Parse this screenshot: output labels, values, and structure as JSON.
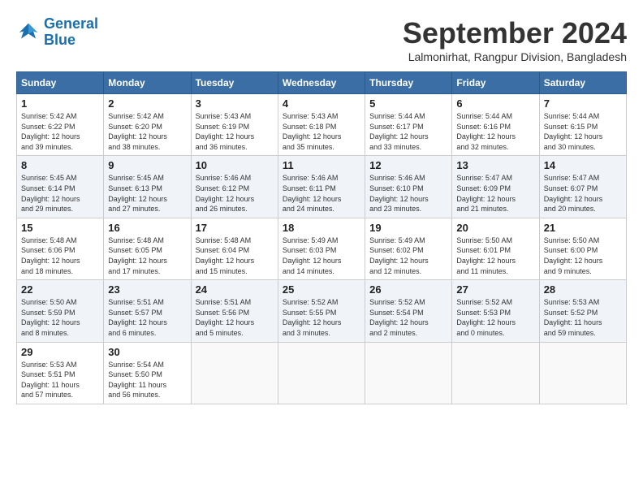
{
  "header": {
    "logo_line1": "General",
    "logo_line2": "Blue",
    "month_title": "September 2024",
    "location": "Lalmonirhat, Rangpur Division, Bangladesh"
  },
  "weekdays": [
    "Sunday",
    "Monday",
    "Tuesday",
    "Wednesday",
    "Thursday",
    "Friday",
    "Saturday"
  ],
  "weeks": [
    [
      {
        "day": 1,
        "info": "Sunrise: 5:42 AM\nSunset: 6:22 PM\nDaylight: 12 hours\nand 39 minutes."
      },
      {
        "day": 2,
        "info": "Sunrise: 5:42 AM\nSunset: 6:20 PM\nDaylight: 12 hours\nand 38 minutes."
      },
      {
        "day": 3,
        "info": "Sunrise: 5:43 AM\nSunset: 6:19 PM\nDaylight: 12 hours\nand 36 minutes."
      },
      {
        "day": 4,
        "info": "Sunrise: 5:43 AM\nSunset: 6:18 PM\nDaylight: 12 hours\nand 35 minutes."
      },
      {
        "day": 5,
        "info": "Sunrise: 5:44 AM\nSunset: 6:17 PM\nDaylight: 12 hours\nand 33 minutes."
      },
      {
        "day": 6,
        "info": "Sunrise: 5:44 AM\nSunset: 6:16 PM\nDaylight: 12 hours\nand 32 minutes."
      },
      {
        "day": 7,
        "info": "Sunrise: 5:44 AM\nSunset: 6:15 PM\nDaylight: 12 hours\nand 30 minutes."
      }
    ],
    [
      {
        "day": 8,
        "info": "Sunrise: 5:45 AM\nSunset: 6:14 PM\nDaylight: 12 hours\nand 29 minutes."
      },
      {
        "day": 9,
        "info": "Sunrise: 5:45 AM\nSunset: 6:13 PM\nDaylight: 12 hours\nand 27 minutes."
      },
      {
        "day": 10,
        "info": "Sunrise: 5:46 AM\nSunset: 6:12 PM\nDaylight: 12 hours\nand 26 minutes."
      },
      {
        "day": 11,
        "info": "Sunrise: 5:46 AM\nSunset: 6:11 PM\nDaylight: 12 hours\nand 24 minutes."
      },
      {
        "day": 12,
        "info": "Sunrise: 5:46 AM\nSunset: 6:10 PM\nDaylight: 12 hours\nand 23 minutes."
      },
      {
        "day": 13,
        "info": "Sunrise: 5:47 AM\nSunset: 6:09 PM\nDaylight: 12 hours\nand 21 minutes."
      },
      {
        "day": 14,
        "info": "Sunrise: 5:47 AM\nSunset: 6:07 PM\nDaylight: 12 hours\nand 20 minutes."
      }
    ],
    [
      {
        "day": 15,
        "info": "Sunrise: 5:48 AM\nSunset: 6:06 PM\nDaylight: 12 hours\nand 18 minutes."
      },
      {
        "day": 16,
        "info": "Sunrise: 5:48 AM\nSunset: 6:05 PM\nDaylight: 12 hours\nand 17 minutes."
      },
      {
        "day": 17,
        "info": "Sunrise: 5:48 AM\nSunset: 6:04 PM\nDaylight: 12 hours\nand 15 minutes."
      },
      {
        "day": 18,
        "info": "Sunrise: 5:49 AM\nSunset: 6:03 PM\nDaylight: 12 hours\nand 14 minutes."
      },
      {
        "day": 19,
        "info": "Sunrise: 5:49 AM\nSunset: 6:02 PM\nDaylight: 12 hours\nand 12 minutes."
      },
      {
        "day": 20,
        "info": "Sunrise: 5:50 AM\nSunset: 6:01 PM\nDaylight: 12 hours\nand 11 minutes."
      },
      {
        "day": 21,
        "info": "Sunrise: 5:50 AM\nSunset: 6:00 PM\nDaylight: 12 hours\nand 9 minutes."
      }
    ],
    [
      {
        "day": 22,
        "info": "Sunrise: 5:50 AM\nSunset: 5:59 PM\nDaylight: 12 hours\nand 8 minutes."
      },
      {
        "day": 23,
        "info": "Sunrise: 5:51 AM\nSunset: 5:57 PM\nDaylight: 12 hours\nand 6 minutes."
      },
      {
        "day": 24,
        "info": "Sunrise: 5:51 AM\nSunset: 5:56 PM\nDaylight: 12 hours\nand 5 minutes."
      },
      {
        "day": 25,
        "info": "Sunrise: 5:52 AM\nSunset: 5:55 PM\nDaylight: 12 hours\nand 3 minutes."
      },
      {
        "day": 26,
        "info": "Sunrise: 5:52 AM\nSunset: 5:54 PM\nDaylight: 12 hours\nand 2 minutes."
      },
      {
        "day": 27,
        "info": "Sunrise: 5:52 AM\nSunset: 5:53 PM\nDaylight: 12 hours\nand 0 minutes."
      },
      {
        "day": 28,
        "info": "Sunrise: 5:53 AM\nSunset: 5:52 PM\nDaylight: 11 hours\nand 59 minutes."
      }
    ],
    [
      {
        "day": 29,
        "info": "Sunrise: 5:53 AM\nSunset: 5:51 PM\nDaylight: 11 hours\nand 57 minutes."
      },
      {
        "day": 30,
        "info": "Sunrise: 5:54 AM\nSunset: 5:50 PM\nDaylight: 11 hours\nand 56 minutes."
      },
      null,
      null,
      null,
      null,
      null
    ]
  ]
}
